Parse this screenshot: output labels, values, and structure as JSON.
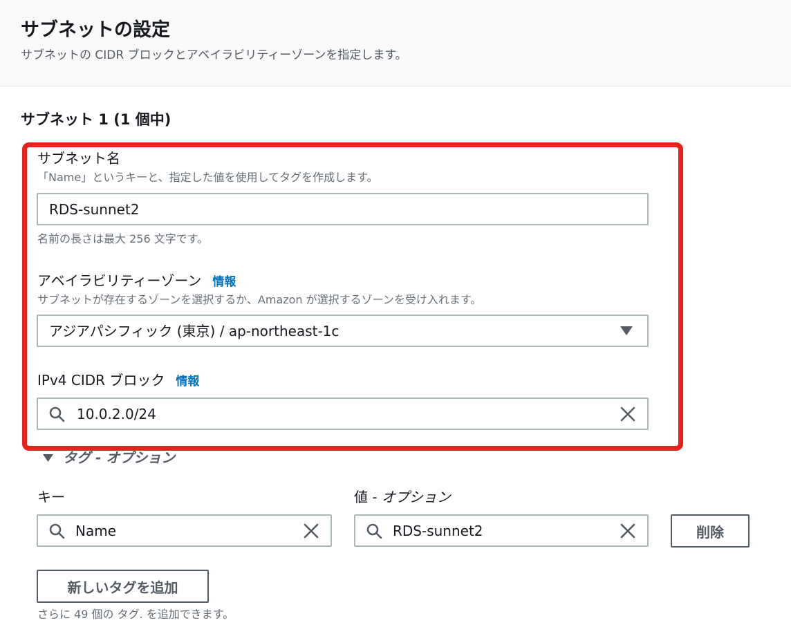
{
  "header": {
    "title": "サブネットの設定",
    "subtitle": "サブネットの CIDR ブロックとアベイラビリティーゾーンを指定します。"
  },
  "subnet": {
    "heading": "サブネット 1 (1 個中)",
    "name": {
      "label": "サブネット名",
      "description": "「Name」というキーと、指定した値を使用してタグを作成します。",
      "value": "RDS-sunnet2",
      "constraint": "名前の長さは最大 256 文字です。"
    },
    "az": {
      "label": "アベイラビリティーゾーン",
      "info": "情報",
      "description": "サブネットが存在するゾーンを選択するか、Amazon が選択するゾーンを受け入れます。",
      "selected": "アジアパシフィック (東京) / ap-northeast-1c"
    },
    "cidr": {
      "label": "IPv4 CIDR ブロック",
      "info": "情報",
      "value": "10.0.2.0/24"
    }
  },
  "tags": {
    "toggle_label": "タグ - オプション",
    "key_header": "キー",
    "value_header_prefix": "値 - ",
    "value_header_suffix": "オプション",
    "rows": [
      {
        "key": "Name",
        "value": "RDS-sunnet2",
        "remove_label": "削除"
      }
    ],
    "add_button": "新しいタグを追加",
    "footer": "さらに 49 個の タグ. を追加できます。"
  },
  "colors": {
    "highlight": "#e8221b",
    "link": "#0073bb",
    "border": "#aab7b8"
  }
}
